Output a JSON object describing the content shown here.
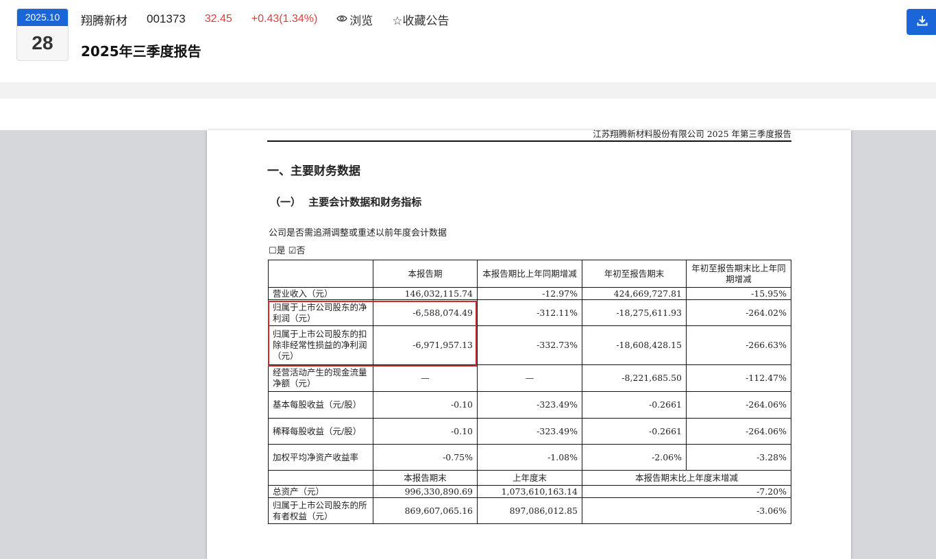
{
  "header": {
    "date_ym": "2025.10",
    "date_day": "28",
    "stock_name": "翔腾新材",
    "stock_code": "001373",
    "price": "32.45",
    "change": "+0.43(1.34%)",
    "browse_label": "浏览",
    "favorite_label": "☆收藏公告",
    "report_title": "2025年三季度报告",
    "accent_color": "#1a66d9",
    "up_color": "#e03c3c"
  },
  "document": {
    "running_head": "江苏翔腾新材料股份有限公司 2025 年第三季度报告",
    "section1": "一、主要财务数据",
    "section2": "（一） 主要会计数据和财务指标",
    "question": "公司是否需追溯调整或重述以前年度会计数据",
    "answer": "☐是 ☑否",
    "table": {
      "headers": [
        "",
        "本报告期",
        "本报告期比上年同期增减",
        "年初至报告期末",
        "年初至报告期末比上年同期增减"
      ],
      "rows": [
        [
          "营业收入（元）",
          "146,032,115.74",
          "-12.97%",
          "424,669,727.81",
          "-15.95%"
        ],
        [
          "归属于上市公司股东的净利润（元）",
          "-6,588,074.49",
          "-312.11%",
          "-18,275,611.93",
          "-264.02%"
        ],
        [
          "归属于上市公司股东的扣除非经常性损益的净利润（元）",
          "-6,971,957.13",
          "-332.73%",
          "-18,608,428.15",
          "-266.63%"
        ],
        [
          "经营活动产生的现金流量净额（元）",
          "—",
          "—",
          "-8,221,685.50",
          "-112.47%"
        ],
        [
          "基本每股收益（元/股）",
          "-0.10",
          "-323.49%",
          "-0.2661",
          "-264.06%"
        ],
        [
          "稀释每股收益（元/股）",
          "-0.10",
          "-323.49%",
          "-0.2661",
          "-264.06%"
        ],
        [
          "加权平均净资产收益率",
          "-0.75%",
          "-1.08%",
          "-2.06%",
          "-3.28%"
        ]
      ],
      "headers2": [
        "",
        "本报告期末",
        "上年度末",
        "本报告期末比上年度末增减"
      ],
      "rows2": [
        [
          "总资产（元）",
          "996,330,890.69",
          "1,073,610,163.14",
          "-7.20%"
        ],
        [
          "归属于上市公司股东的所有者权益（元）",
          "869,607,065.16",
          "897,086,012.85",
          "-3.06%"
        ]
      ]
    }
  }
}
